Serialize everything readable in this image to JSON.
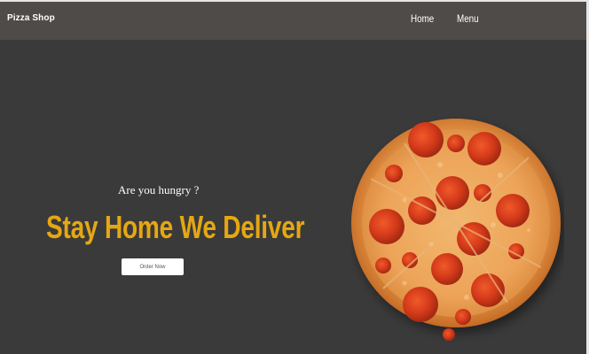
{
  "navbar": {
    "brand": "Pizza Shop",
    "links": [
      {
        "label": "Home"
      },
      {
        "label": "Menu"
      }
    ]
  },
  "hero": {
    "subtitle": "Are you hungry ?",
    "title": "Stay Home We Deliver",
    "cta_label": "Order Now",
    "title_color": "#e5a712"
  },
  "colors": {
    "background": "#3a3a3a",
    "navbar": "#4e4b49"
  },
  "image": {
    "icon": "pepperoni-pizza-image"
  }
}
